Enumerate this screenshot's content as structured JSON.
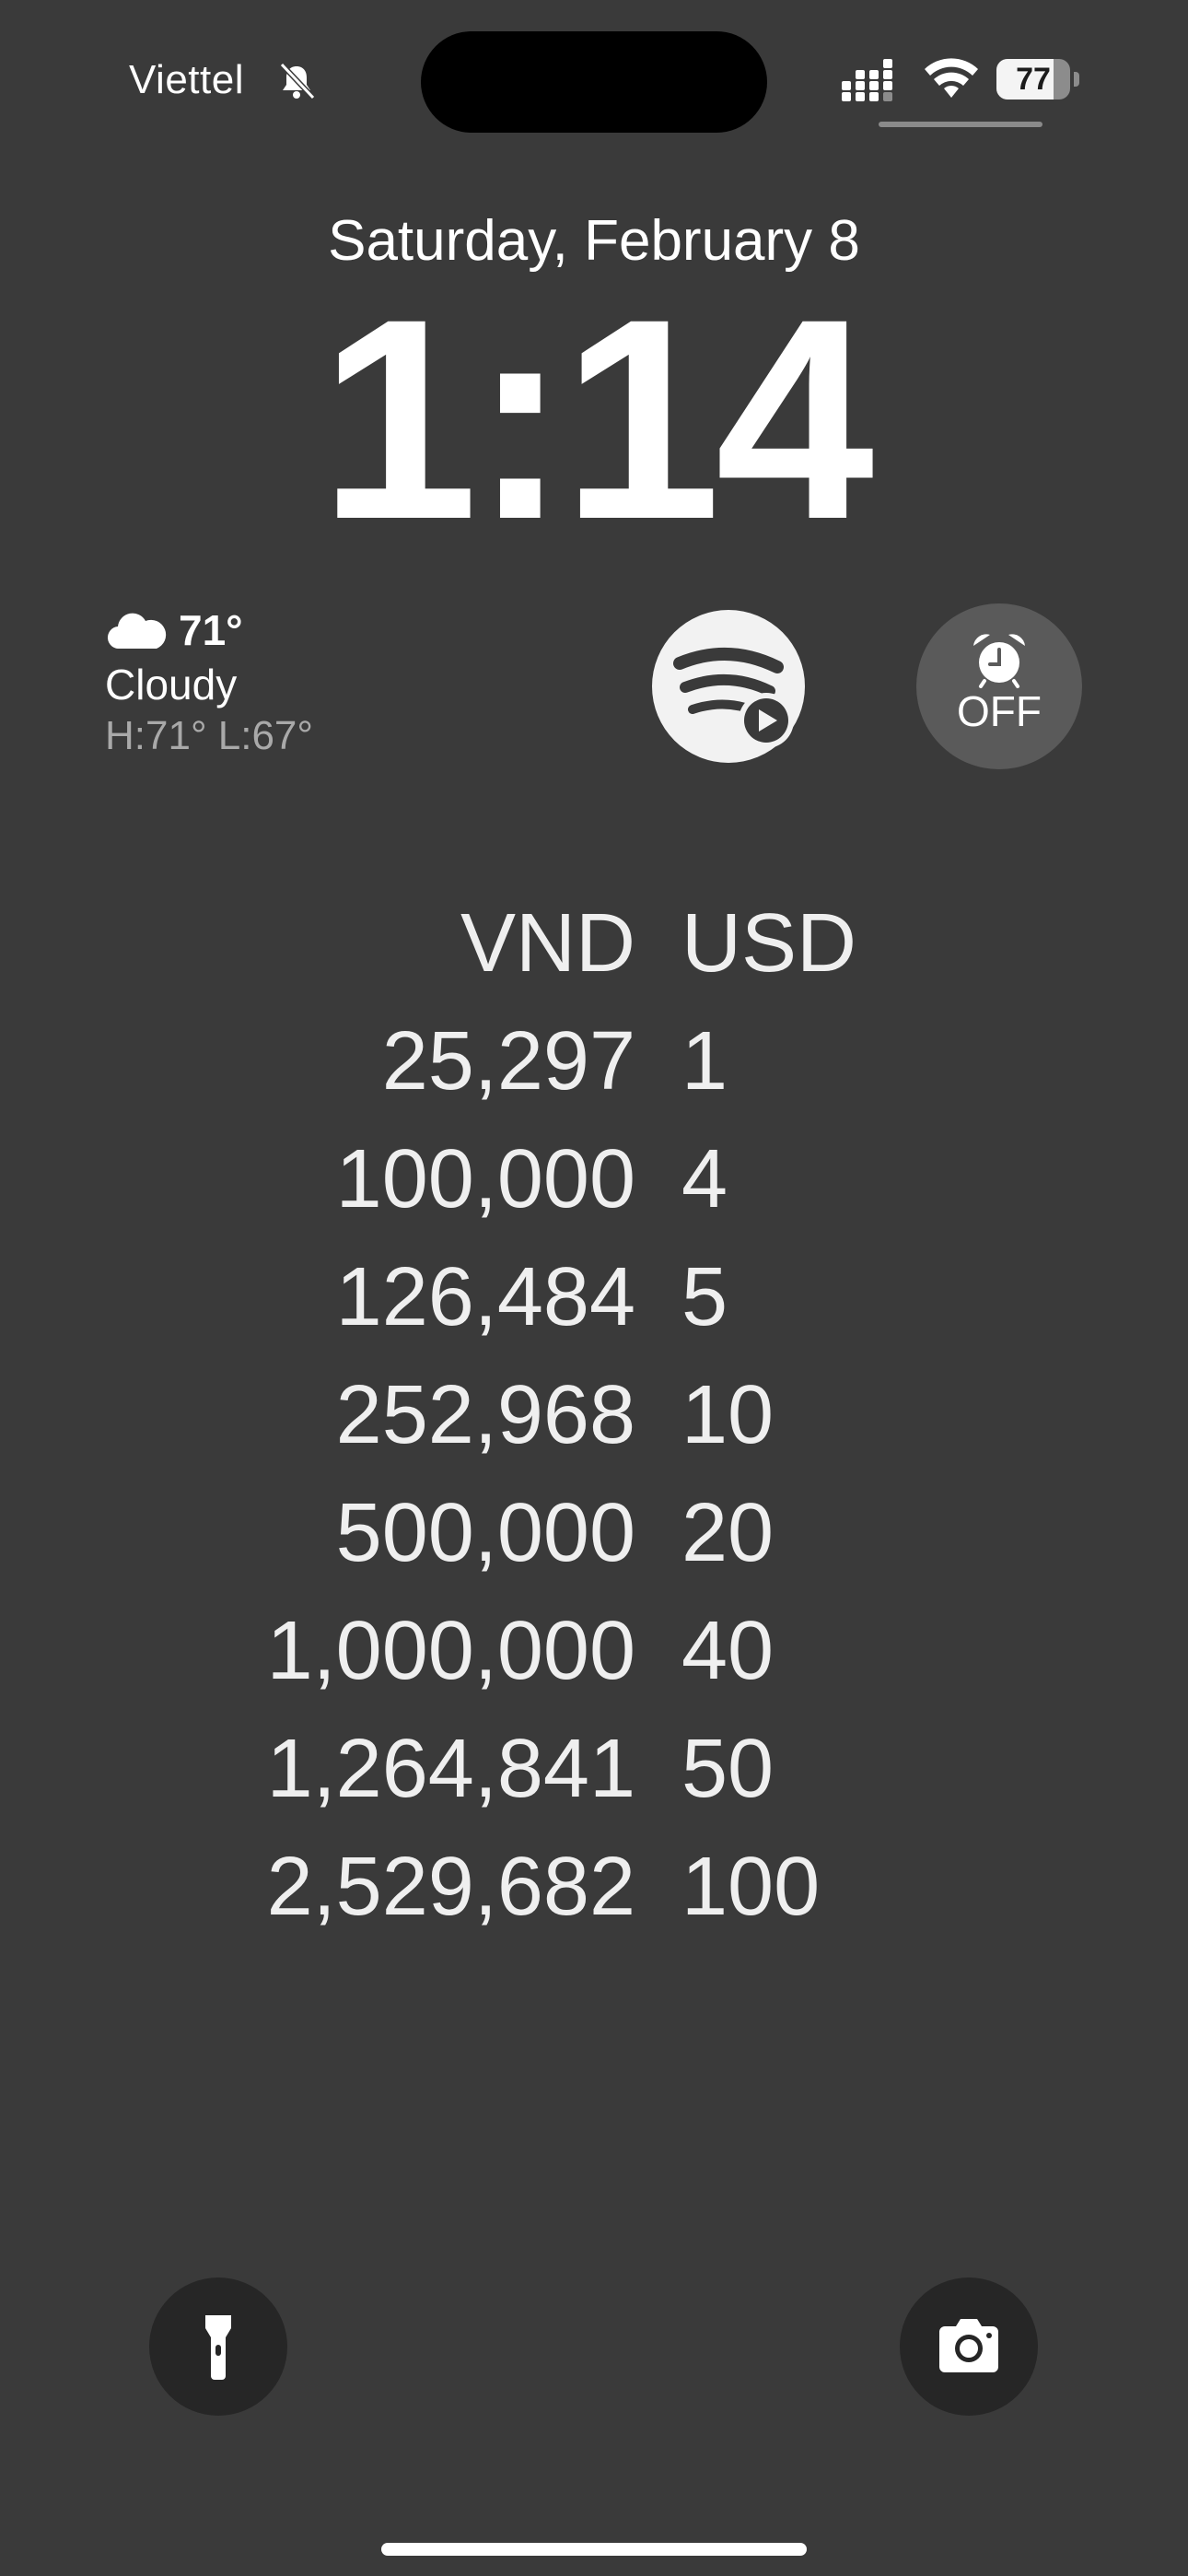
{
  "status_bar": {
    "carrier": "Viettel",
    "battery_percent": 77,
    "battery_label": "77"
  },
  "lock_screen": {
    "date": "Saturday, February 8",
    "time": "1:14"
  },
  "widgets": {
    "weather": {
      "temperature": "71°",
      "condition": "Cloudy",
      "high_low": "H:71° L:67°",
      "icon": "cloud-icon"
    },
    "spotify": {
      "icon": "spotify-play-icon"
    },
    "alarm": {
      "icon": "alarm-clock-icon",
      "label": "OFF"
    }
  },
  "currency_table": {
    "header": {
      "vnd": "VND",
      "usd": "USD"
    },
    "rows": [
      {
        "vnd": "25,297",
        "usd": "1"
      },
      {
        "vnd": "100,000",
        "usd": "4"
      },
      {
        "vnd": "126,484",
        "usd": "5"
      },
      {
        "vnd": "252,968",
        "usd": "10"
      },
      {
        "vnd": "500,000",
        "usd": "20"
      },
      {
        "vnd": "1,000,000",
        "usd": "40"
      },
      {
        "vnd": "1,264,841",
        "usd": "50"
      },
      {
        "vnd": "2,529,682",
        "usd": "100"
      }
    ]
  },
  "bottom_buttons": {
    "left": "flashlight-icon",
    "right": "camera-icon"
  }
}
